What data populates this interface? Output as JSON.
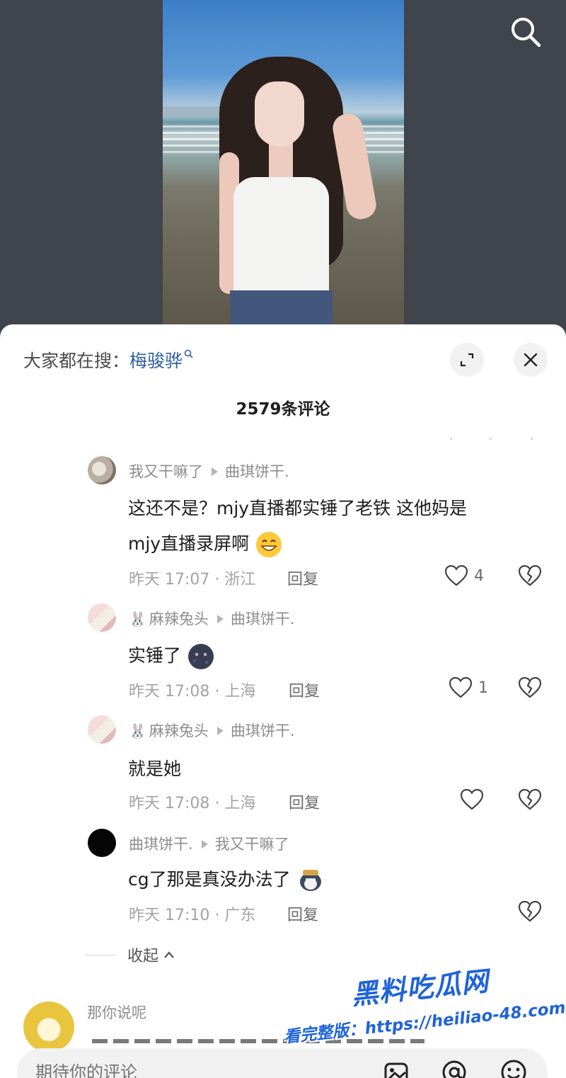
{
  "trending": {
    "prefix": "大家都在搜：",
    "keyword": "梅骏骅"
  },
  "comments_header": {
    "count_text": "2579条评论"
  },
  "replies": [
    {
      "author": "我又干嘛了",
      "reply_to": "曲琪饼干.",
      "text_1": "这还不是？mjy直播都实锤了老铁 这他妈是",
      "text_2": "mjy直播录屏啊",
      "time": "昨天 17:07 · 浙江",
      "reply_label": "回复",
      "likes": "4",
      "emoji": "grinning-emoji"
    },
    {
      "author_prefix_icon": "rabbit-face",
      "author": "麻辣兔头",
      "reply_to": "曲琪饼干.",
      "text_1": "实锤了",
      "time": "昨天 17:08 · 上海",
      "reply_label": "回复",
      "likes": "1",
      "emoji": "dark-moon-face-emoji"
    },
    {
      "author_prefix_icon": "rabbit-face",
      "author": "麻辣兔头",
      "reply_to": "曲琪饼干.",
      "text_1": "就是她",
      "time": "昨天 17:08 · 上海",
      "reply_label": "回复",
      "likes": ""
    },
    {
      "author": "曲琪饼干.",
      "reply_to": "我又干嘛了",
      "text_1": "cg了那是真没办法了",
      "time": "昨天 17:10 · 广东",
      "reply_label": "回复",
      "likes": "",
      "emoji": "penguin-sticker-emoji"
    }
  ],
  "collapse_label": "收起",
  "next_comment": {
    "author": "那你说呢"
  },
  "input": {
    "placeholder": "期待你的评论"
  },
  "icons": [
    "search-icon",
    "expand-icon",
    "close-icon",
    "heart-icon",
    "broken-heart-icon",
    "image-icon",
    "at-icon",
    "emoji-icon",
    "chevron-up-icon"
  ],
  "watermark": {
    "line1": "黑料吃瓜网",
    "line2": "看完整版：https://heiliao-48.com"
  },
  "colors": {
    "keyword": "#2f5f9e",
    "watermark": "#1f63d9",
    "sheet_bg": "#ffffff",
    "video_bg": "#40444c"
  }
}
